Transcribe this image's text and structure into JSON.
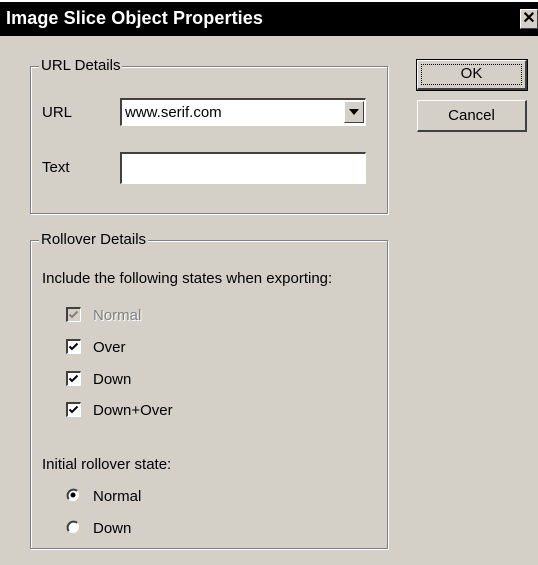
{
  "dialog": {
    "title": "Image Slice Object Properties",
    "close_glyph": "✕"
  },
  "buttons": {
    "ok": "OK",
    "cancel": "Cancel"
  },
  "url_group": {
    "legend": "URL Details",
    "url_label": "URL",
    "url_value": "www.serif.com",
    "text_label": "Text",
    "text_value": ""
  },
  "rollover_group": {
    "legend": "Rollover Details",
    "instructions": "Include the following states when exporting:",
    "states": [
      {
        "label": "Normal",
        "checked": true,
        "enabled": false
      },
      {
        "label": "Over",
        "checked": true,
        "enabled": true
      },
      {
        "label": "Down",
        "checked": true,
        "enabled": true
      },
      {
        "label": "Down+Over",
        "checked": true,
        "enabled": true
      }
    ],
    "initial_label": "Initial rollover state:",
    "initial_options": [
      {
        "label": "Normal",
        "selected": true
      },
      {
        "label": "Down",
        "selected": false
      }
    ]
  },
  "icons": {
    "close": "close-icon",
    "dropdown": "chevron-down-icon",
    "check": "checkmark-icon"
  }
}
